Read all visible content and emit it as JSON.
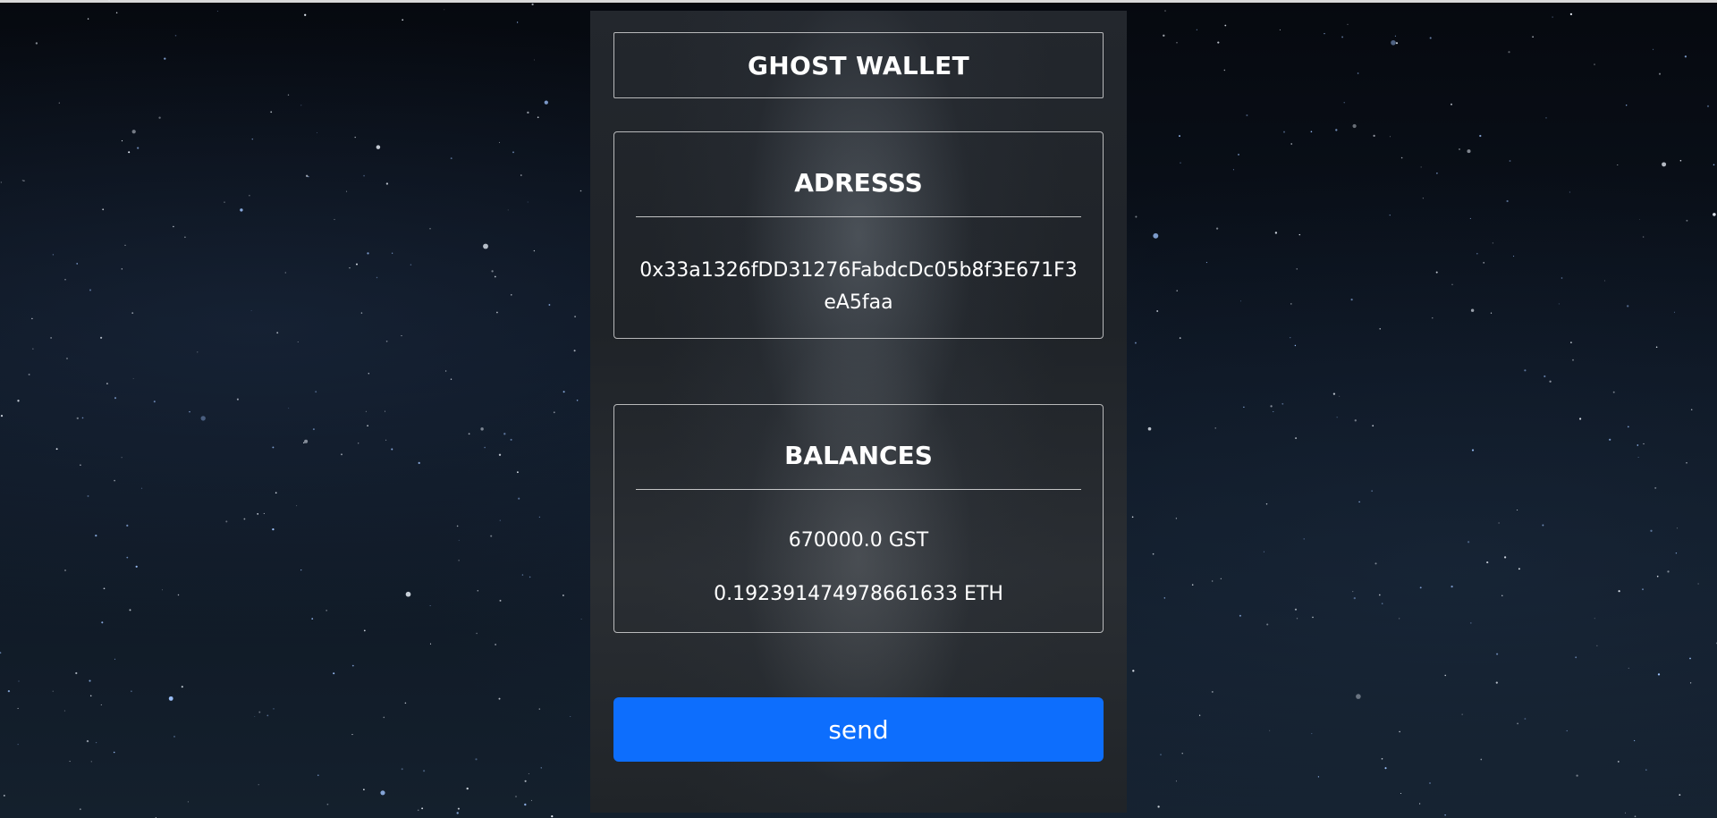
{
  "wallet": {
    "title": "GHOST WALLET"
  },
  "address": {
    "heading": "ADRESSS",
    "value": "0x33a1326fDD31276FabdcDc05b8f3E671F3eA5faa"
  },
  "balances": {
    "heading": "BALANCES",
    "items": [
      {
        "amount": "670000.0",
        "symbol": "GST",
        "label": "670000.0 GST"
      },
      {
        "amount": "0.192391474978661633",
        "symbol": "ETH",
        "label": "0.192391474978661633 ETH"
      }
    ]
  },
  "actions": {
    "send_label": "send"
  },
  "colors": {
    "accent": "#0d6efd",
    "panel": "#23272d",
    "text": "#ffffff"
  }
}
